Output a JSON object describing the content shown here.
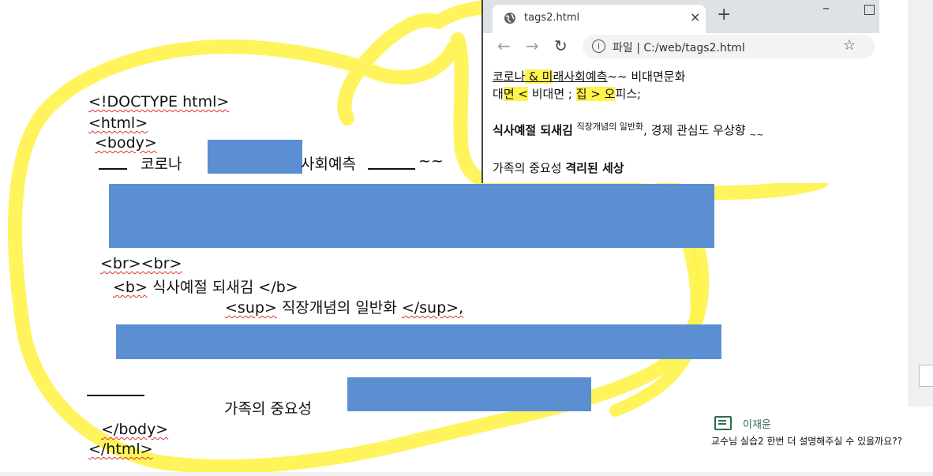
{
  "code": {
    "doctype": "<!DOCTYPE html>",
    "html_open": "<html>",
    "body_open": "<body>",
    "line1_word": "코로나",
    "line1_after": "사회예측",
    "line1_tilde": "~~",
    "br": "<br><br>",
    "b_open": "<b>",
    "b_text": "식사예절 되새김",
    "b_close": "</b>",
    "sup_open": "<sup>",
    "sup_text": "직장개념의 일반화",
    "sup_close": "</sup>,",
    "family": "가족의 중요성",
    "body_close": "</body>",
    "html_close": "</html>"
  },
  "browser": {
    "tab_title": "tags2.html",
    "tab_close": "×",
    "new_tab": "+",
    "minimize": "–",
    "url_prefix": "파일",
    "url_sep": "|",
    "url": "C:/web/tags2.html",
    "back": "←",
    "forward": "→",
    "reload": "↻",
    "star": "☆",
    "info": "i",
    "content": {
      "l1_a": "코로나",
      "l1_b": " & 미",
      "l1_c": "래사회예측",
      "l1_d": "~~ 비대면문화",
      "l2_a": "대",
      "l2_b": "면 <",
      "l2_c": " 비대면 ; ",
      "l2_d": "집 >",
      "l2_e": " 오",
      "l2_f": "피스;",
      "l3_b": "식사예절 되새김",
      "l3_sup": "직장개념의 일반화",
      "l3_rest": ", 경제 관심도 우상향",
      "l3_sub": "~~",
      "l4_a": "가족의 중요성 ",
      "l4_b": "격리된 세상"
    }
  },
  "chat": {
    "name": "이재윤",
    "message": "교수님 실습2 한번 더 설명해주실 수 있을까요??"
  },
  "colors": {
    "highlighter": "#fff34d",
    "answer_box": "#5b8fd1",
    "chat_accent": "#2a6e4d"
  }
}
